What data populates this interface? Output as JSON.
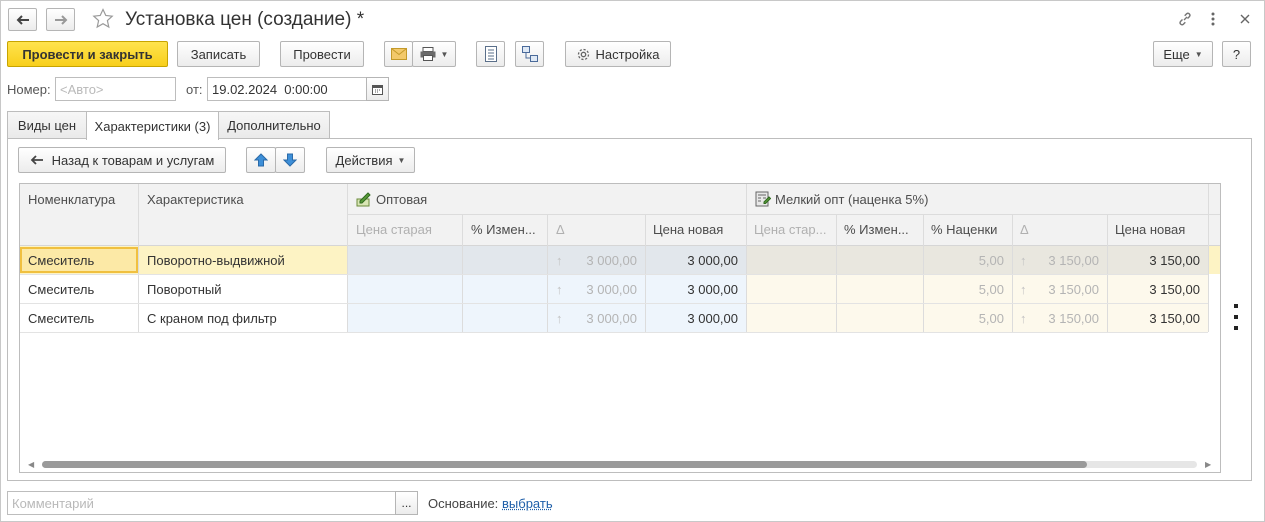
{
  "window": {
    "title": "Установка цен (создание) *"
  },
  "toolbar": {
    "post_and_close": "Провести и закрыть",
    "save": "Записать",
    "post": "Провести",
    "settings": "Настройка",
    "more": "Еще",
    "help": "?"
  },
  "header_fields": {
    "number_label": "Номер:",
    "number_placeholder": "<Авто>",
    "date_label": "от:",
    "date_value": "19.02.2024  0:00:00"
  },
  "tabs": [
    {
      "label": "Виды цен"
    },
    {
      "label": "Характеристики (3)"
    },
    {
      "label": "Дополнительно"
    }
  ],
  "panel_toolbar": {
    "back": "Назад к товарам и услугам",
    "actions": "Действия"
  },
  "grid": {
    "col_nomenclature": "Номенклатура",
    "col_characteristic": "Характеристика",
    "group_wholesale": "Оптовая",
    "group_small_wholesale": "Мелкий опт (наценка 5%)",
    "wholesale_cols": [
      "Цена старая",
      "% Измен...",
      "Δ",
      "Цена новая"
    ],
    "small_cols": [
      "Цена стар...",
      "% Измен...",
      "% Наценки",
      "Δ",
      "Цена новая"
    ],
    "rows": [
      {
        "nomenclature": "Смеситель",
        "characteristic": "Поворотно-выдвижной",
        "w_delta": "3 000,00",
        "w_new": "3 000,00",
        "s_markup": "5,00",
        "s_delta": "3 150,00",
        "s_new": "3 150,00"
      },
      {
        "nomenclature": "Смеситель",
        "characteristic": "Поворотный",
        "w_delta": "3 000,00",
        "w_new": "3 000,00",
        "s_markup": "5,00",
        "s_delta": "3 150,00",
        "s_new": "3 150,00"
      },
      {
        "nomenclature": "Смеситель",
        "characteristic": "С краном под фильтр",
        "w_delta": "3 000,00",
        "w_new": "3 000,00",
        "s_markup": "5,00",
        "s_delta": "3 150,00",
        "s_new": "3 150,00"
      }
    ]
  },
  "footer": {
    "comment_placeholder": "Комментарий",
    "ellipsis": "...",
    "basis_label": "Основание:",
    "basis_link": "выбрать"
  },
  "colors": {
    "primary_button": "#f8cf1c",
    "selected_row": "#fdf3c4",
    "wholesale_bg": "#eef5fc",
    "small_bg": "#fdf9ec"
  }
}
